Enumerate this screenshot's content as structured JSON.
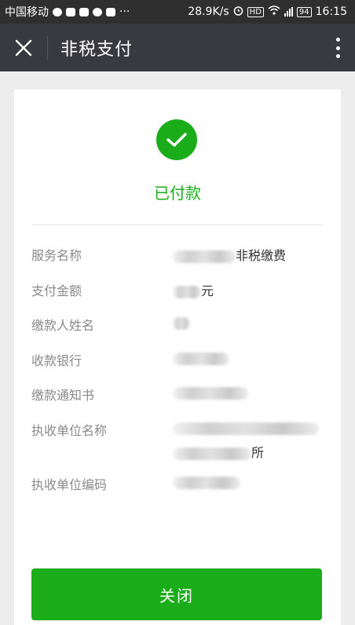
{
  "statusbar": {
    "carrier": "中国移动",
    "speed": "28.9K/s",
    "hd": "HD",
    "battery": "94",
    "time": "16:15",
    "more": "···"
  },
  "navbar": {
    "title": "非税支付"
  },
  "payment": {
    "status": "已付款",
    "rows": [
      {
        "label": "服务名称",
        "value": "非税缴费"
      },
      {
        "label": "支付金额",
        "value": "元"
      },
      {
        "label": "缴款人姓名",
        "value": ""
      },
      {
        "label": "收款银行",
        "value": ""
      },
      {
        "label": "缴款通知书",
        "value": ""
      },
      {
        "label": "执收单位名称",
        "value": "所"
      },
      {
        "label": "执收单位编码",
        "value": ""
      }
    ]
  },
  "footer": {
    "close_label": "关闭"
  },
  "colors": {
    "accent": "#1aad19",
    "navbar": "#393a3f",
    "statusbar": "#2f2f30"
  }
}
